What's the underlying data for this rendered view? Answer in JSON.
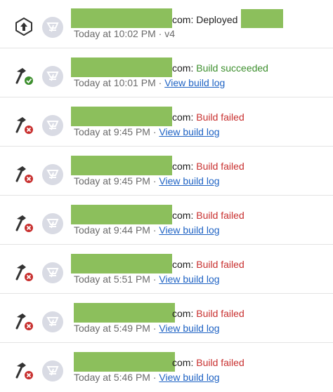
{
  "feed": {
    "items": [
      {
        "suffix": "com:",
        "status": "Deployed",
        "status_kind": "neutral",
        "time": "Today at 10:02 PM",
        "extra": " · v4",
        "link": "",
        "icon": "deploy-upload-icon"
      },
      {
        "suffix": "com:",
        "status": "Build succeeded",
        "status_kind": "success",
        "time": "Today at 10:01 PM",
        "extra": " · ",
        "link": "View build log",
        "icon": "build-success-icon"
      },
      {
        "suffix": "com:",
        "status": "Build failed",
        "status_kind": "failed",
        "time": "Today at 9:45 PM",
        "extra": " · ",
        "link": "View build log",
        "icon": "build-failed-icon"
      },
      {
        "suffix": "com:",
        "status": "Build failed",
        "status_kind": "failed",
        "time": "Today at 9:45 PM",
        "extra": " · ",
        "link": "View build log",
        "icon": "build-failed-icon"
      },
      {
        "suffix": "com:",
        "status": "Build failed",
        "status_kind": "failed",
        "time": "Today at 9:44 PM",
        "extra": " · ",
        "link": "View build log",
        "icon": "build-failed-icon"
      },
      {
        "suffix": "com:",
        "status": "Build failed",
        "status_kind": "failed",
        "time": "Today at 5:51 PM",
        "extra": " · ",
        "link": "View build log",
        "icon": "build-failed-icon"
      },
      {
        "suffix": "com:",
        "status": "Build failed",
        "status_kind": "failed",
        "time": "Today at 5:49 PM",
        "extra": " · ",
        "link": "View build log",
        "icon": "build-failed-icon"
      },
      {
        "suffix": "com:",
        "status": "Build failed",
        "status_kind": "failed",
        "time": "Today at 5:46 PM",
        "extra": " · ",
        "link": "View build log",
        "icon": "build-failed-icon"
      }
    ]
  },
  "colors": {
    "success": "#3d8f2e",
    "failed": "#c8302f",
    "link": "#1f63c4",
    "redaction": "#8cbf5c",
    "avatar_bg": "#d9dbe4"
  }
}
